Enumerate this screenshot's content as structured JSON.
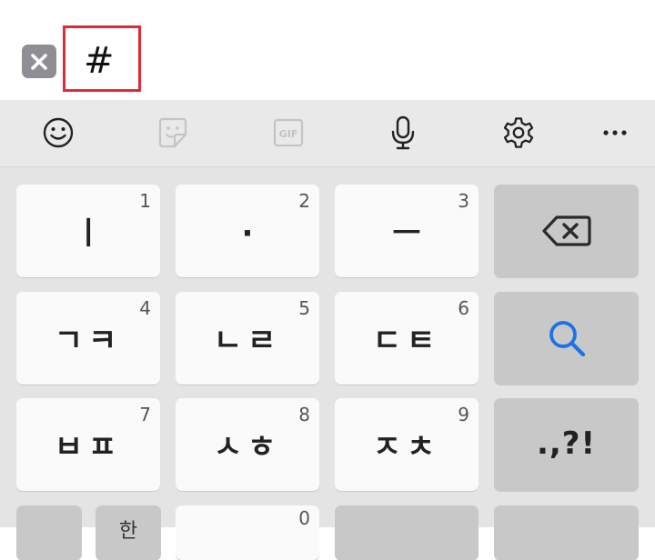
{
  "search": {
    "query": "#"
  },
  "toolbar": {
    "icons": [
      "emoji-icon",
      "sticker-icon",
      "gif-icon",
      "microphone-icon",
      "settings-icon",
      "more-icon"
    ],
    "gif_label": "GIF"
  },
  "keys": {
    "row1": [
      {
        "label": "ㅣ",
        "num": "1"
      },
      {
        "label": "·",
        "num": "2"
      },
      {
        "label": "ㅡ",
        "num": "3"
      }
    ],
    "row2": [
      {
        "label": "ㄱㅋ",
        "num": "4"
      },
      {
        "label": "ㄴㄹ",
        "num": "5"
      },
      {
        "label": "ㄷㅌ",
        "num": "6"
      }
    ],
    "row3": [
      {
        "label": "ㅂㅍ",
        "num": "7"
      },
      {
        "label": "ㅅㅎ",
        "num": "8"
      },
      {
        "label": "ㅈㅊ",
        "num": "9"
      }
    ],
    "row4": {
      "partial_label": "한",
      "zero_num": "0"
    },
    "punctuation": ".,?!"
  },
  "colors": {
    "accent": "#1a73e8",
    "highlight_border": "#e02a35",
    "key_bg": "#fafafa",
    "func_key_bg": "#c8c8c8",
    "keyboard_bg": "#e4e4e4"
  }
}
